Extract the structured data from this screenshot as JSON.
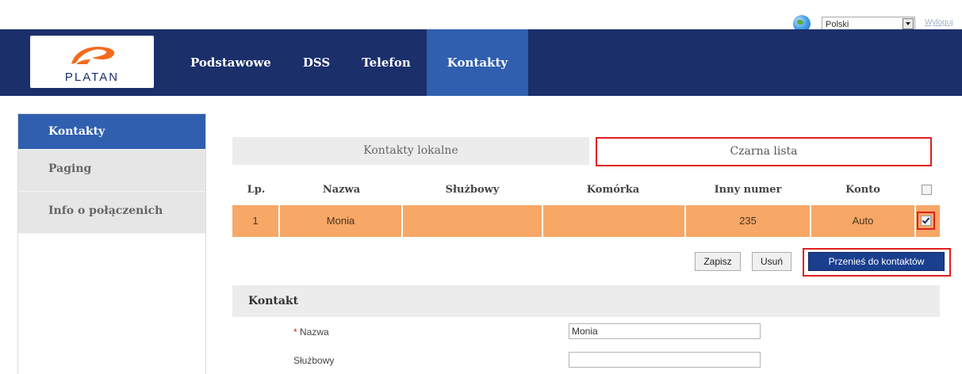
{
  "language": {
    "selected": "Polski",
    "logout_label": "Wyloguj"
  },
  "brand": {
    "logo_text": "PLATAN"
  },
  "nav": [
    {
      "label": "Podstawowe",
      "active": false
    },
    {
      "label": "DSS",
      "active": false
    },
    {
      "label": "Telefon",
      "active": false
    },
    {
      "label": "Kontakty",
      "active": true
    }
  ],
  "sidebar": [
    {
      "label": "Kontakty",
      "active": true
    },
    {
      "label": "Paging",
      "active": false
    },
    {
      "label": "Info o połączenich",
      "active": false
    }
  ],
  "tabs": {
    "local": "Kontakty lokalne",
    "blacklist": "Czarna lista"
  },
  "table": {
    "headers": [
      "Lp.",
      "Nazwa",
      "Służbowy",
      "Komórka",
      "Inny numer",
      "Konto"
    ],
    "rows": [
      {
        "lp": "1",
        "nazwa": "Monia",
        "sluzbowy": "",
        "komorka": "",
        "inny_numer": "235",
        "konto": "Auto",
        "checked": true
      }
    ]
  },
  "actions": {
    "save": "Zapisz",
    "delete": "Usuń",
    "move": "Przenieś do kontaktów"
  },
  "contact": {
    "heading": "Kontakt",
    "required_mark": "*",
    "name_label": "Nazwa",
    "name_value": "Monia",
    "work_label": "Służbowy",
    "work_value": ""
  },
  "colors": {
    "header": "#1b2f6b",
    "accent": "#2f5fae",
    "row_highlight": "#f7a766",
    "callout": "#e0201e"
  }
}
